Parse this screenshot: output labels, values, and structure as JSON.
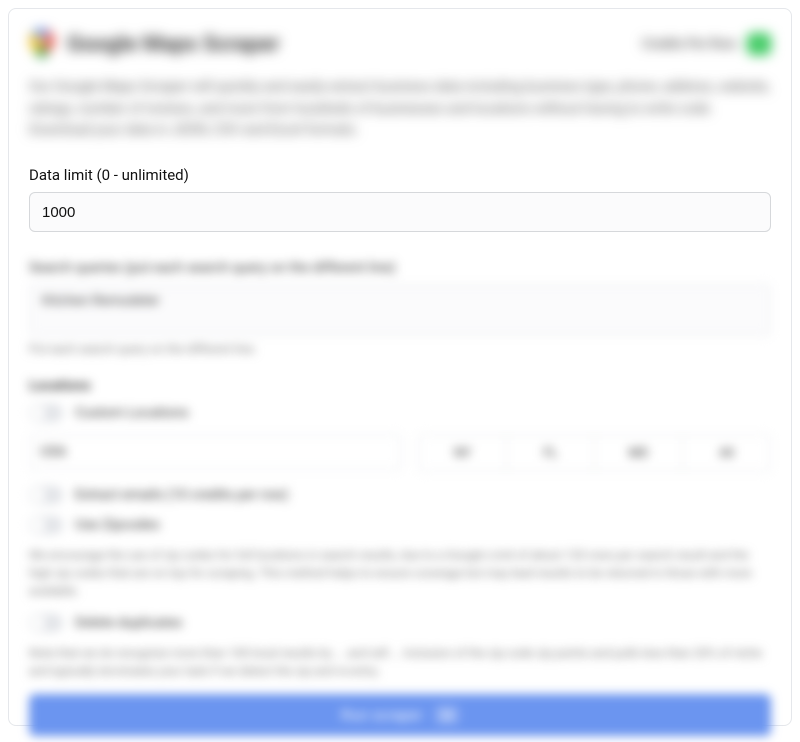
{
  "header": {
    "title": "Google Maps Scraper",
    "credits_label": "Credits Per Row:",
    "credits_value": "1"
  },
  "description": "Our Google Maps Scraper will quickly and easily extract business data including business type, phone, address, website, ratings, number of reviews, and more from hundreds of businesses and locations without having to write code. Download your data in JSON, CSV and Excel formats.",
  "data_limit": {
    "label": "Data limit (0 - unlimited)",
    "value": "1000"
  },
  "search_queries": {
    "label": "Search queries (put each search query on the different line)",
    "value": "Kitchen Remodeler",
    "hint": "Put each search query on the different line."
  },
  "locations": {
    "section_label": "Locations",
    "custom_label": "Custom Locations",
    "country": "USA",
    "pills": [
      "NY",
      "FL",
      "MD",
      "All"
    ]
  },
  "extract_emails_label": "Extract emails (10 credits per row)",
  "use_zipcodes_label": "Use Zipcodes",
  "zip_desc": "We encourage the use of zip codes for full locations in search results, due to a Google Limit of about 120 rows per search result and the high zip codes that are on top for scraping. This method helps to ensure coverage but may lead results to be returned in those with more available.",
  "delete_dupes_label": "Delete duplicates",
  "dupes_desc": "Note that we do recognize more than 100 local results by ... and will ... Inclusion of the zip code zip points and pulls less than 20% of niche and typically terminates your task if we detect the zip and re-entry.",
  "run": {
    "label": "Run scraper",
    "badge": "1k"
  }
}
